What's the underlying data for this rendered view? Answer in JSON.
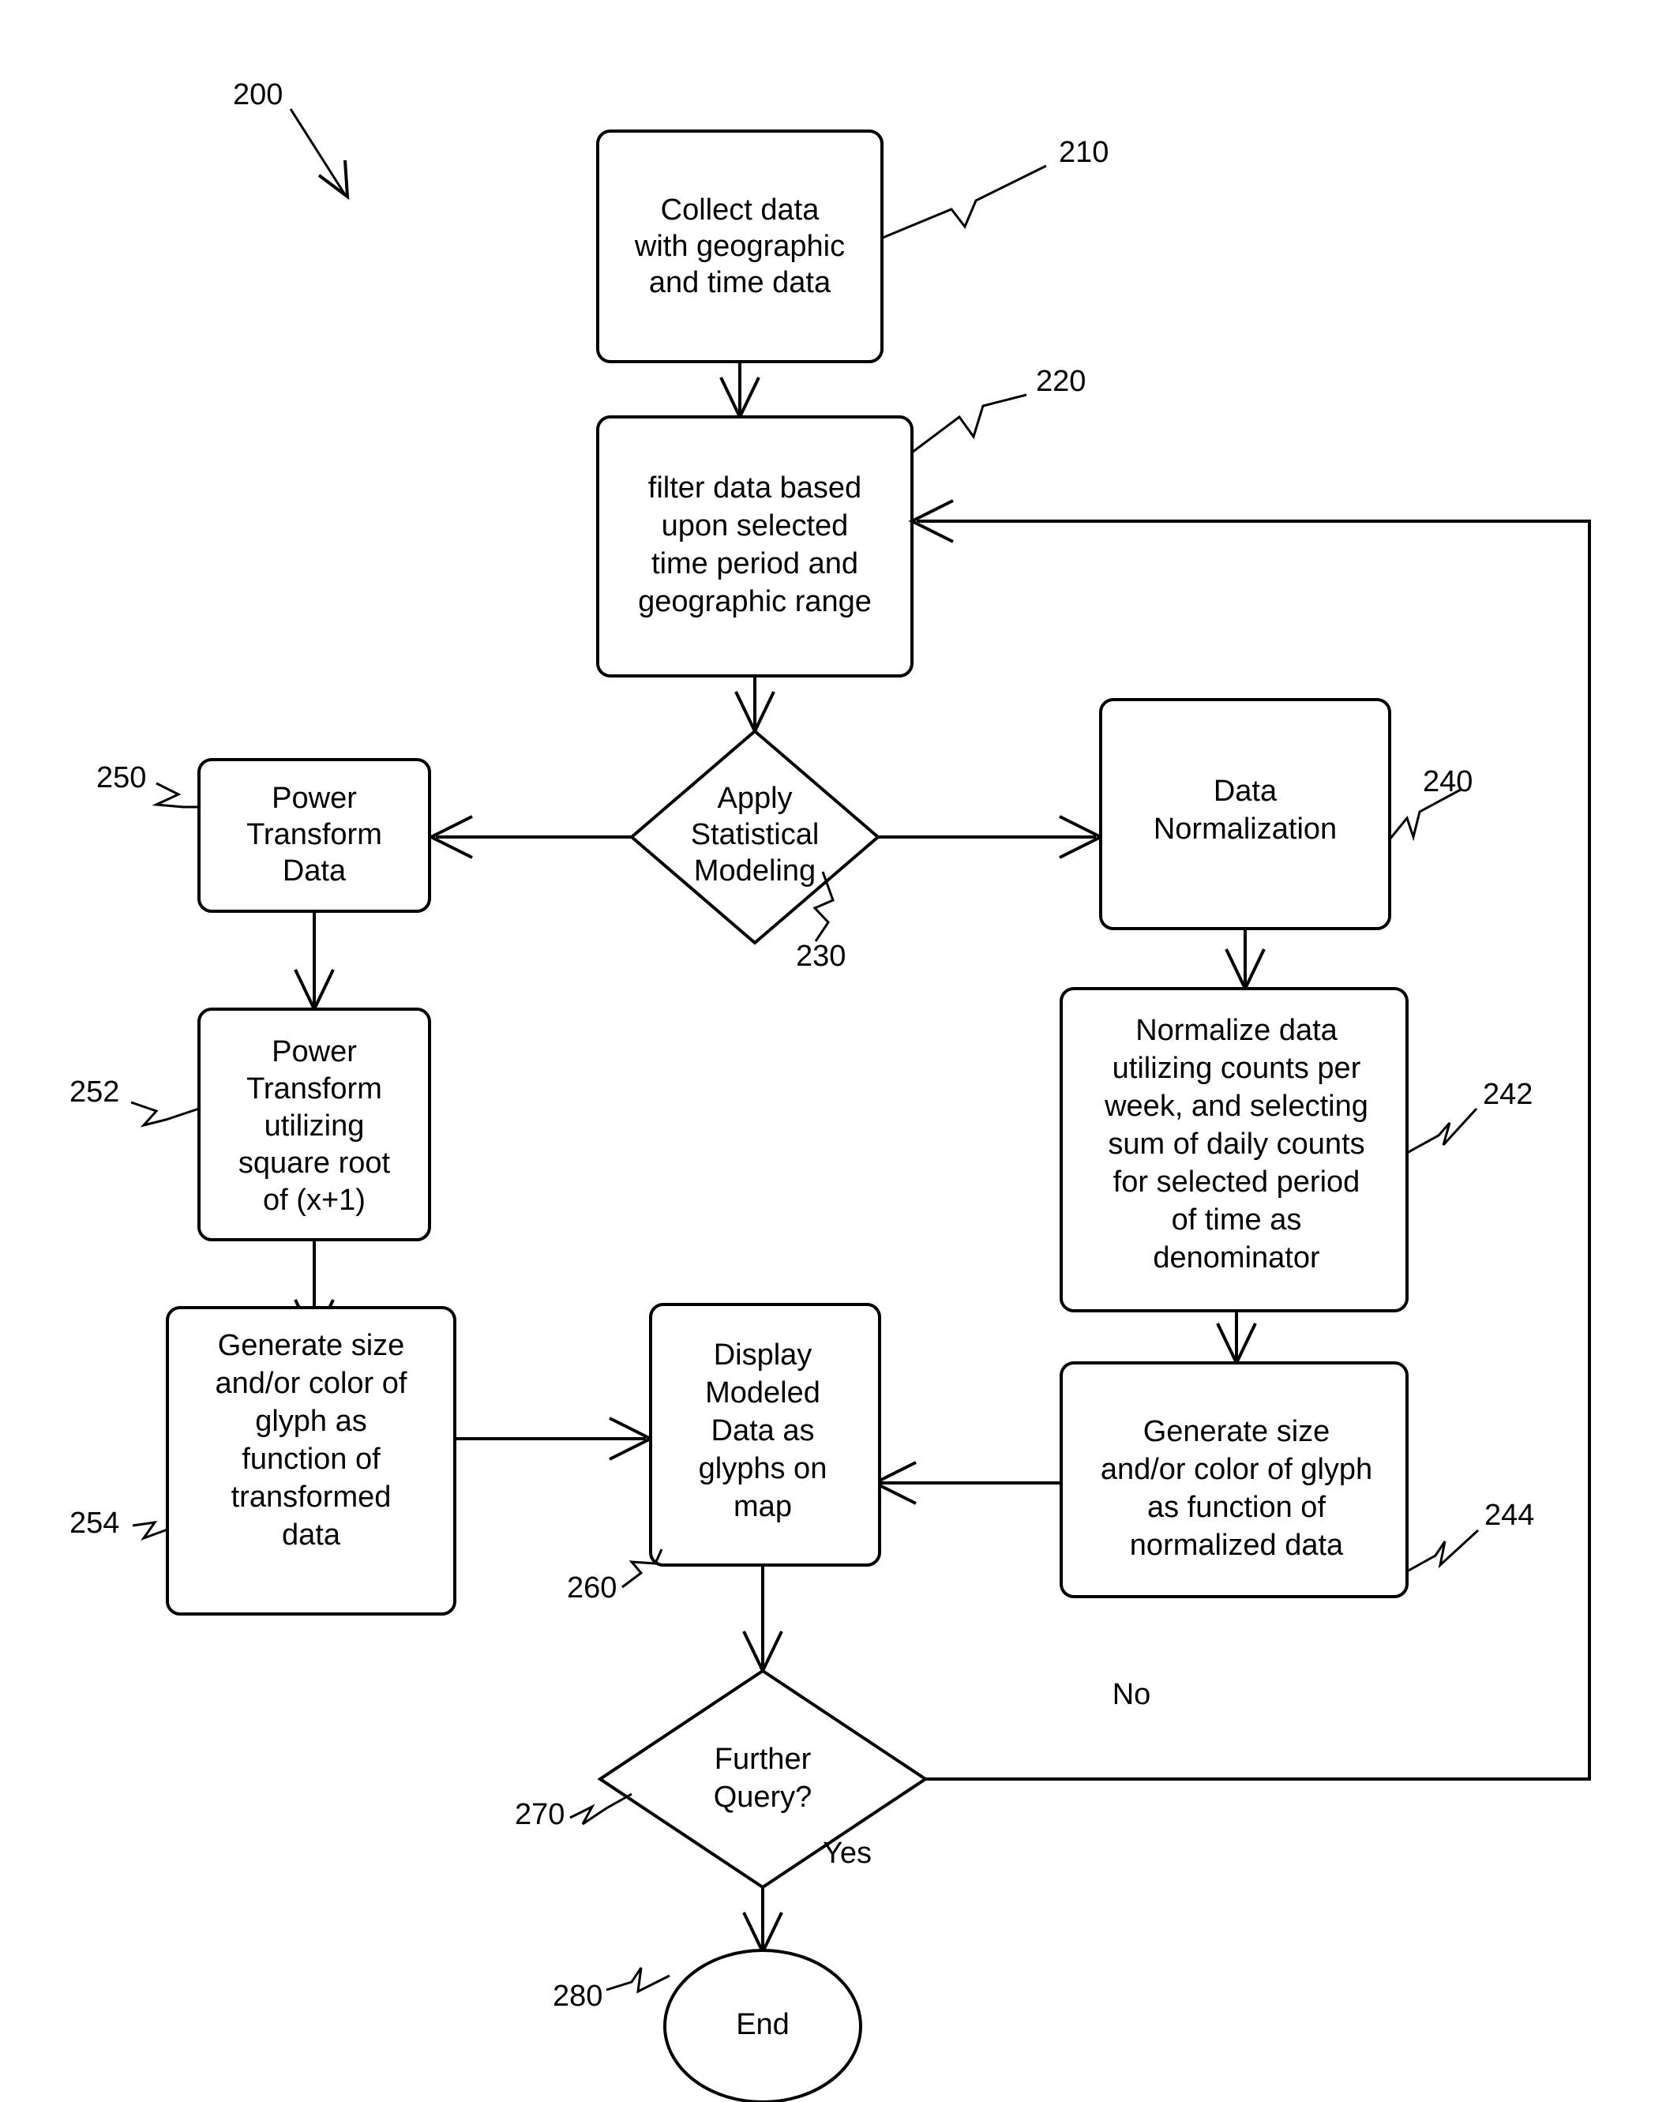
{
  "figure": {
    "ref": "200",
    "title": "Flowchart for statistical modeling and display of geographic time data"
  },
  "nodes": [
    {
      "id": "collect",
      "ref": "210",
      "shape": "process",
      "lines": [
        "Collect data",
        "with geographic",
        "and time data"
      ]
    },
    {
      "id": "filter",
      "ref": "220",
      "shape": "process",
      "lines": [
        "filter data based",
        "upon selected",
        "time period and",
        "geographic range"
      ]
    },
    {
      "id": "apply-statistical-modeling",
      "ref": "230",
      "shape": "decision",
      "lines": [
        "Apply",
        "Statistical",
        "Modeling"
      ]
    },
    {
      "id": "data-normalization",
      "ref": "240",
      "shape": "process",
      "lines": [
        "Data",
        "Normalization"
      ]
    },
    {
      "id": "normalize-data",
      "ref": "242",
      "shape": "process",
      "lines": [
        "Normalize data",
        "utilizing counts per",
        "week, and selecting",
        "sum of daily counts",
        "for selected period",
        "of time as",
        "denominator"
      ]
    },
    {
      "id": "generate-normalized-glyph",
      "ref": "244",
      "shape": "process",
      "lines": [
        "Generate size",
        "and/or color of glyph",
        "as function of",
        "normalized data"
      ]
    },
    {
      "id": "power-transform-data",
      "ref": "250",
      "shape": "process",
      "lines": [
        "Power",
        "Transform",
        "Data"
      ]
    },
    {
      "id": "power-transform-sqrt",
      "ref": "252",
      "shape": "process",
      "lines": [
        "Power",
        "Transform",
        "utilizing",
        "square root",
        "of (x+1)"
      ]
    },
    {
      "id": "generate-transformed-glyph",
      "ref": "254",
      "shape": "process",
      "lines": [
        "Generate size",
        "and/or color of",
        "glyph as",
        "function of",
        "transformed",
        "data"
      ]
    },
    {
      "id": "display-modeled-data",
      "ref": "260",
      "shape": "process",
      "lines": [
        "Display",
        "Modeled",
        "Data as",
        "glyphs on",
        "map"
      ]
    },
    {
      "id": "further-query",
      "ref": "270",
      "shape": "decision",
      "lines": [
        "Further",
        "Query?"
      ]
    },
    {
      "id": "end",
      "ref": "280",
      "shape": "terminator",
      "lines": [
        "End"
      ]
    }
  ],
  "edge_labels": {
    "no": "No",
    "yes": "Yes"
  },
  "colors": {
    "stroke": "#000000",
    "fill": "#ffffff",
    "text": "#000000"
  }
}
